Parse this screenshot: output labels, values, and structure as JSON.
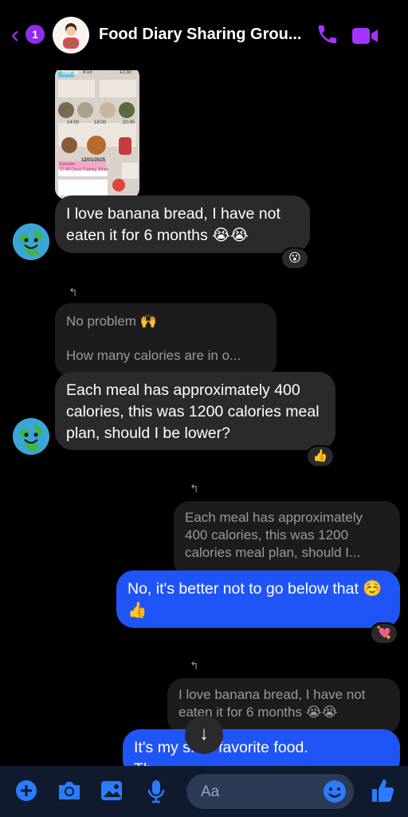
{
  "header": {
    "back_badge": "1",
    "title": "Food Diary Sharing Grou..."
  },
  "photo": {
    "day_tag": "DAY 24",
    "date": "12/01/2025",
    "exercise": "Exercise",
    "plan": "17:40 Chest Training 30min",
    "times": [
      "8:15",
      "12:30",
      "14:00",
      "18:00",
      "20:45"
    ]
  },
  "messages": [
    {
      "id": "m1",
      "text": "I love banana bread, I have not eaten it for 6 months 😭😭",
      "reaction": "😮"
    },
    {
      "id": "m2",
      "quote_line1": "No problem 🙌",
      "quote_line2": "How many calories are in o...",
      "text": "Each meal has approximately 400 calories, this was 1200 calories meal plan, should I be lower?",
      "reaction": "👍"
    },
    {
      "id": "m3",
      "quote": "Each meal has approximately 400 calories, this was 1200 calories meal plan, should I...",
      "text": "No, it's better not to go below that ☺️👍",
      "reaction": "💘"
    },
    {
      "id": "m4",
      "quote": "I love banana bread, I have not eaten it for 6 months 😭😭",
      "text": "It's my s...'s favorite food.",
      "text2": "Th..."
    }
  ],
  "composer": {
    "placeholder": "Aa"
  },
  "colors": {
    "accent": "#a335ff",
    "outgoing_bubble": "#1f55f6",
    "incoming_bubble": "#2a2a2c",
    "composer_icon": "#2b7bff"
  },
  "icons": [
    "back-arrow-icon",
    "phone-icon",
    "video-icon",
    "reply-icon",
    "scroll-down-icon",
    "plus-icon",
    "camera-icon",
    "gallery-icon",
    "microphone-icon",
    "emoji-icon",
    "like-icon"
  ]
}
